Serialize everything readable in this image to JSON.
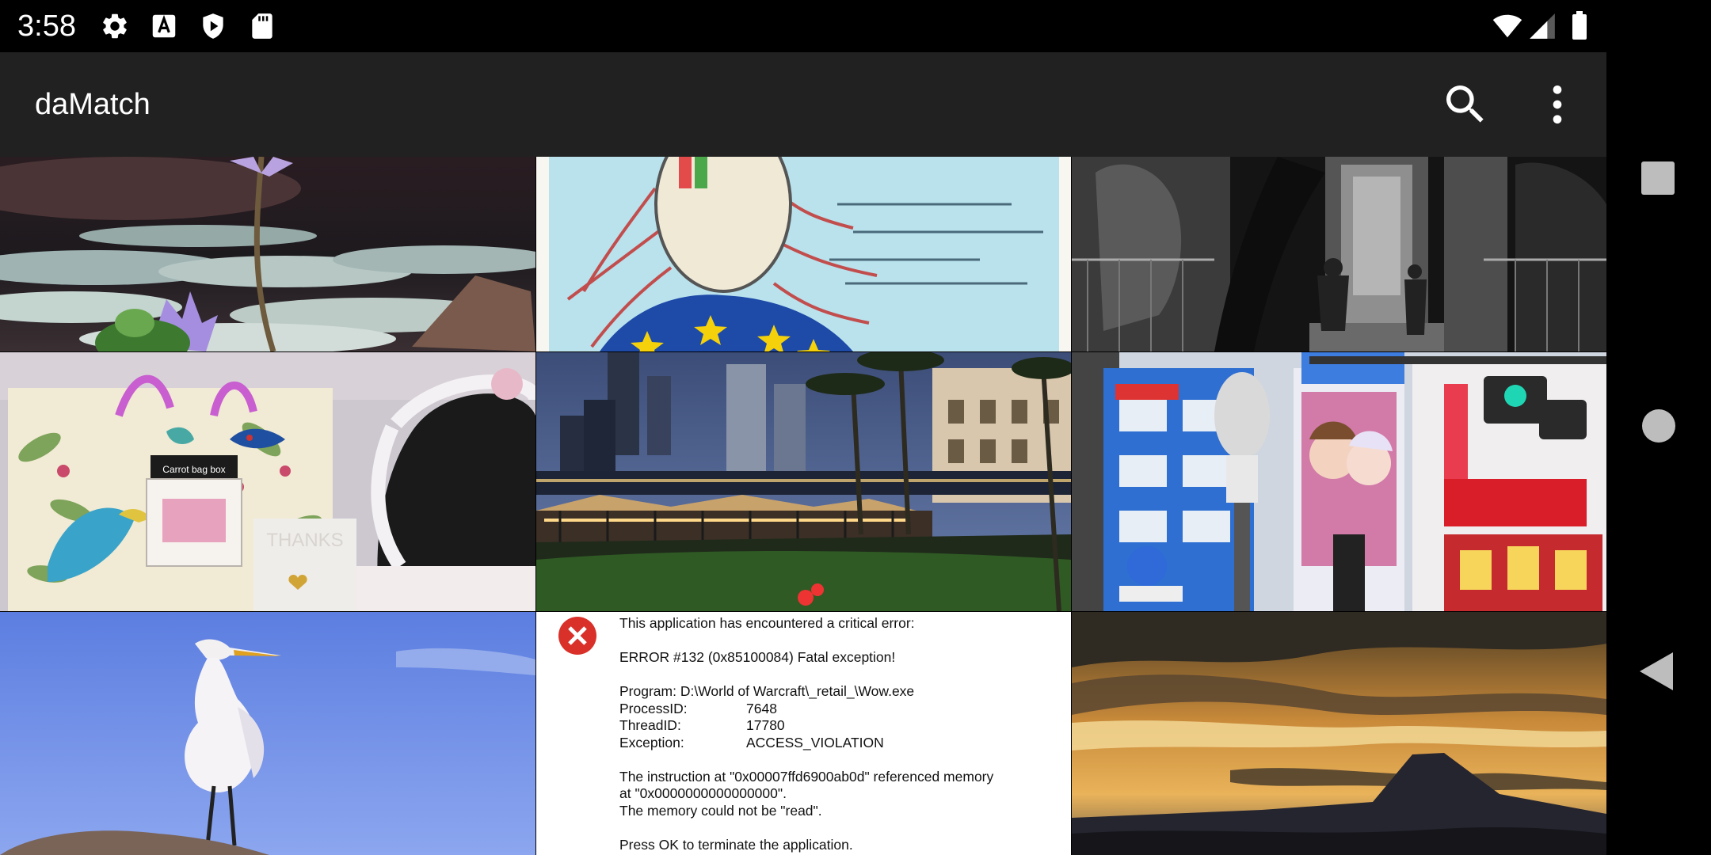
{
  "status_bar": {
    "time": "3:58",
    "left_icons": [
      "gear-icon",
      "a-box-icon",
      "play-shield-icon",
      "sd-card-icon"
    ],
    "right_icons": [
      "wifi-icon",
      "cell-signal-icon",
      "battery-icon"
    ]
  },
  "app_bar": {
    "title": "daMatch",
    "actions": [
      "search-icon",
      "overflow-menu-icon"
    ]
  },
  "grid": {
    "columns": 3,
    "tiles": [
      {
        "subject": "water-lily"
      },
      {
        "subject": "eu-flag-portrait-illustration"
      },
      {
        "subject": "bw-doorway-street"
      },
      {
        "subject": "bird-gift-bag"
      },
      {
        "subject": "night-city-waterfront"
      },
      {
        "subject": "city-street-billboards"
      },
      {
        "subject": "egret-blue-sky"
      },
      {
        "subject": "error-dialog-screenshot"
      },
      {
        "subject": "mountain-sunset"
      }
    ],
    "labels": {
      "gift_card": "Carrot bag box",
      "thanks_card": "THANKS"
    },
    "error_dialog": {
      "icon": "error-x-icon",
      "headline": "This application has encountered a critical error:",
      "error_code": "ERROR #132 (0x85100084) Fatal exception!",
      "program": "Program: D:\\World of Warcraft\\_retail_\\Wow.exe",
      "process_label": "ProcessID:",
      "process_value": "7648",
      "thread_label": "ThreadID:",
      "thread_value": "17780",
      "exception_label": "Exception:",
      "exception_value": "ACCESS_VIOLATION",
      "instruction_1": "The instruction at \"0x00007ffd6900ab0d\" referenced memory",
      "instruction_2": "at \"0x0000000000000000\".",
      "instruction_3": "The memory could not be \"read\".",
      "footer": "Press OK to terminate the application."
    }
  },
  "nav_bar": {
    "buttons": [
      "recents-square-icon",
      "home-circle-icon",
      "back-triangle-icon"
    ]
  },
  "colors": {
    "status_bar_bg": "#000000",
    "app_bar_bg": "#212121",
    "nav_icon": "#bdbdbd"
  }
}
